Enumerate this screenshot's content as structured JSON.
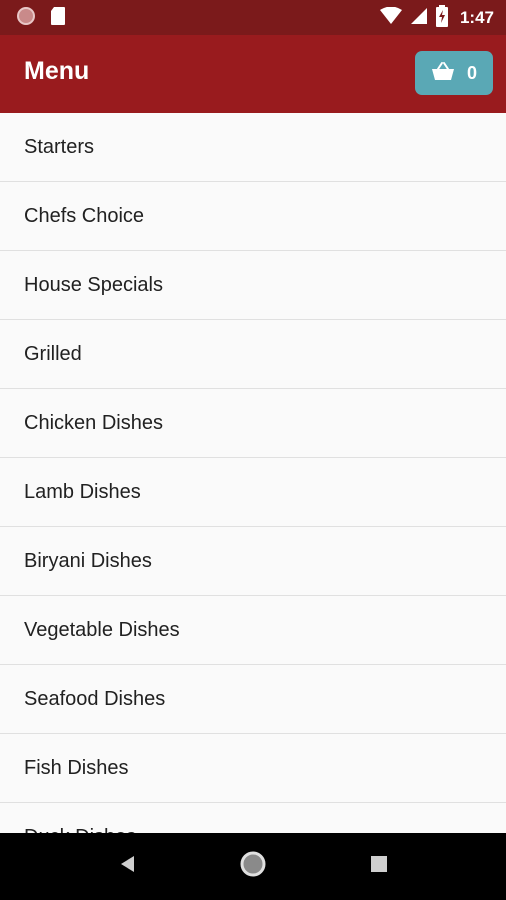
{
  "status_bar": {
    "time": "1:47",
    "bg_color": "#7b1a1b",
    "left_icons": [
      "notification-dot-icon",
      "sd-card-icon"
    ],
    "right_icons": [
      "wifi-icon",
      "cellular-signal-icon",
      "battery-charging-icon"
    ]
  },
  "app_bar": {
    "title": "Menu",
    "bg_color": "#991b1e",
    "cart": {
      "icon": "basket-icon",
      "count": "0",
      "bg_color": "#5aa8b5"
    }
  },
  "menu": {
    "items": [
      {
        "label": "Starters"
      },
      {
        "label": "Chefs Choice"
      },
      {
        "label": "House Specials"
      },
      {
        "label": "Grilled"
      },
      {
        "label": "Chicken Dishes"
      },
      {
        "label": "Lamb Dishes"
      },
      {
        "label": "Biryani Dishes"
      },
      {
        "label": "Vegetable Dishes"
      },
      {
        "label": "Seafood Dishes"
      },
      {
        "label": "Fish Dishes"
      },
      {
        "label": "Duck Dishes"
      }
    ]
  },
  "nav_bar": {
    "buttons": [
      "back-icon",
      "home-icon",
      "recents-icon"
    ]
  }
}
